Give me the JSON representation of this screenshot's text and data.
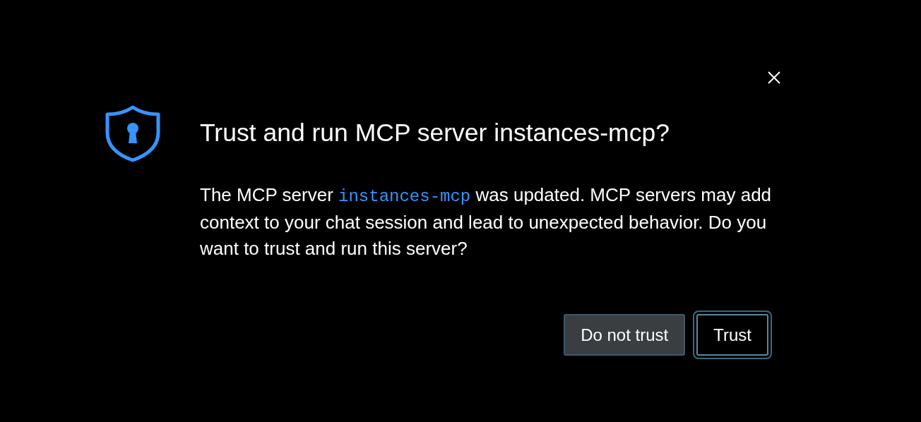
{
  "dialog": {
    "title": "Trust and run MCP server instances-mcp?",
    "message": [
      {
        "kind": "text",
        "text": "The MCP server "
      },
      {
        "kind": "code",
        "text": "instances-mcp"
      },
      {
        "kind": "text",
        "text": " was updated. MCP servers may add context to your chat session and lead to unexpected behavior. Do you want to trust and run this server?"
      }
    ],
    "buttons": [
      {
        "label": "Do not trust",
        "kind": "secondary",
        "focused": false
      },
      {
        "label": "Trust",
        "kind": "plain",
        "focused": true
      }
    ]
  }
}
